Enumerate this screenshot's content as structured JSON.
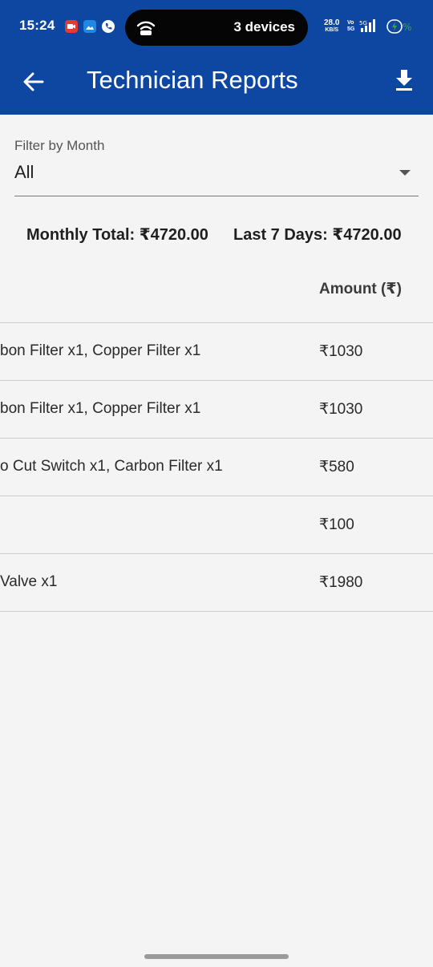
{
  "status_bar": {
    "time": "15:24",
    "island_text": "3 devices",
    "net_speed": "28.0",
    "net_unit": "KB/S",
    "volte_top": "Vo",
    "volte_bottom": "5G",
    "battery": "5G%"
  },
  "app_bar": {
    "title": "Technician Reports",
    "icons": [
      "back-arrow-icon",
      "download-icon"
    ]
  },
  "filter": {
    "label": "Filter by Month",
    "value": "All"
  },
  "totals": {
    "monthly": "Monthly Total: ₹4720.00",
    "last7": "Last 7 Days: ₹4720.00"
  },
  "table": {
    "amount_header": "Amount (₹)",
    "rows": [
      {
        "items": "bon Filter x1, Copper Filter x1",
        "amount": "₹1030"
      },
      {
        "items": "bon Filter x1, Copper Filter x1",
        "amount": "₹1030"
      },
      {
        "items": "o Cut Switch x1, Carbon Filter x1",
        "amount": "₹580"
      },
      {
        "items": "",
        "amount": "₹100"
      },
      {
        "items": " Valve x1",
        "amount": "₹1980"
      }
    ]
  },
  "colors": {
    "app_bar": "#0d47a1",
    "background": "#f4f4f4"
  }
}
